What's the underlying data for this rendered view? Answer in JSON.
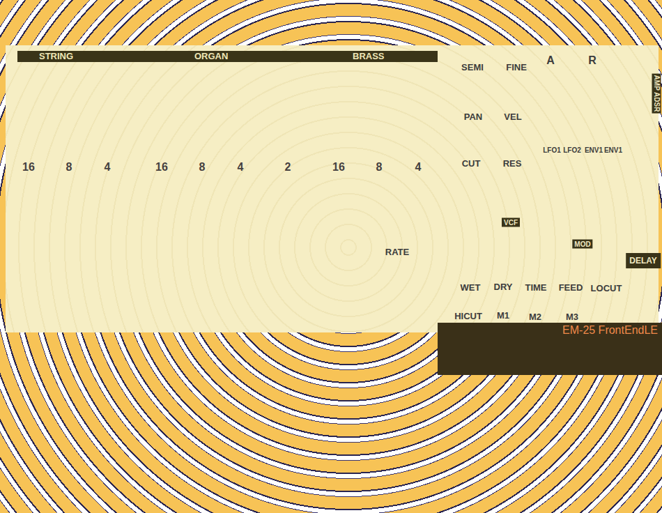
{
  "sections": [
    {
      "label": "STRING",
      "footages": [
        "16",
        "8",
        "4"
      ]
    },
    {
      "label": "ORGAN",
      "footages": [
        "16",
        "8",
        "4",
        "2"
      ]
    },
    {
      "label": "BRASS",
      "footages": [
        "16",
        "8",
        "4"
      ]
    }
  ],
  "controls": [
    {
      "label": "SEMI",
      "kind": "normal"
    },
    {
      "label": "FINE",
      "kind": "normal"
    },
    {
      "label": "A",
      "kind": "large"
    },
    {
      "label": "R",
      "kind": "large"
    },
    {
      "label": "PAN",
      "kind": "normal"
    },
    {
      "label": "VEL",
      "kind": "normal"
    },
    {
      "label": "CUT",
      "kind": "normal"
    },
    {
      "label": "RES",
      "kind": "normal"
    },
    {
      "label": "LFO1",
      "kind": "small"
    },
    {
      "label": "LFO2",
      "kind": "small"
    },
    {
      "label": "ENV1",
      "kind": "small"
    },
    {
      "label": "ENV1",
      "kind": "small"
    },
    {
      "label": "RATE",
      "kind": "normal"
    },
    {
      "label": "WET",
      "kind": "normal"
    },
    {
      "label": "DRY",
      "kind": "normal"
    },
    {
      "label": "TIME",
      "kind": "normal"
    },
    {
      "label": "FEED",
      "kind": "normal"
    },
    {
      "label": "LOCUT",
      "kind": "normal"
    },
    {
      "label": "HICUT",
      "kind": "normal"
    },
    {
      "label": "M1",
      "kind": "normal"
    },
    {
      "label": "M2",
      "kind": "normal"
    },
    {
      "label": "M3",
      "kind": "normal"
    }
  ],
  "badges": [
    {
      "label": "VCF",
      "kind": "tag"
    },
    {
      "label": "MOD",
      "kind": "tag"
    },
    {
      "label": "DELAY",
      "kind": "big"
    },
    {
      "label": "AMP ADSR",
      "kind": "vertical"
    }
  ],
  "product": "EM-25 FrontEndLE"
}
